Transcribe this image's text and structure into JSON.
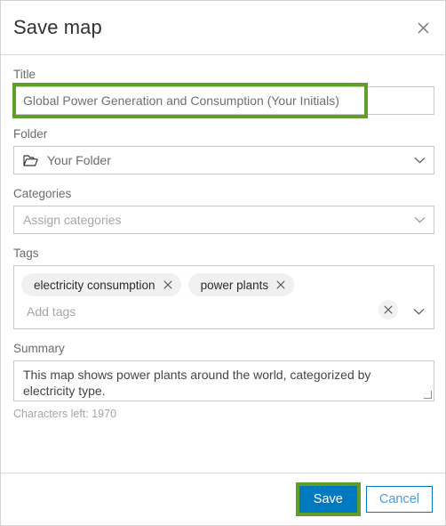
{
  "dialog": {
    "title": "Save map",
    "close_icon": "close-icon"
  },
  "fields": {
    "title": {
      "label": "Title",
      "value": "Global Power Generation and Consumption (Your Initials)",
      "placeholder": "Title"
    },
    "folder": {
      "label": "Folder",
      "value": "Your Folder",
      "icon": "folder-icon",
      "chevron": "chevron-down-icon"
    },
    "categories": {
      "label": "Categories",
      "placeholder": "Assign categories",
      "chevron": "chevron-down-icon"
    },
    "tags": {
      "label": "Tags",
      "items": [
        {
          "label": "electricity consumption",
          "remove_icon": "close-icon"
        },
        {
          "label": "power plants",
          "remove_icon": "close-icon"
        }
      ],
      "placeholder": "Add tags",
      "clear_icon": "close-icon",
      "chevron": "chevron-down-icon"
    },
    "summary": {
      "label": "Summary",
      "value": "This map shows power plants around the world, categorized by electricity type.",
      "characters_left": "Characters left: 1970"
    }
  },
  "footer": {
    "save_label": "Save",
    "cancel_label": "Cancel"
  },
  "colors": {
    "accent_blue": "#0079c1",
    "highlight_green": "#5f9e28",
    "cancel_text": "#4b9ed6",
    "border_gray": "#c8c8c8",
    "label_gray": "#6b6b6b",
    "placeholder_gray": "#a6a6a6"
  }
}
